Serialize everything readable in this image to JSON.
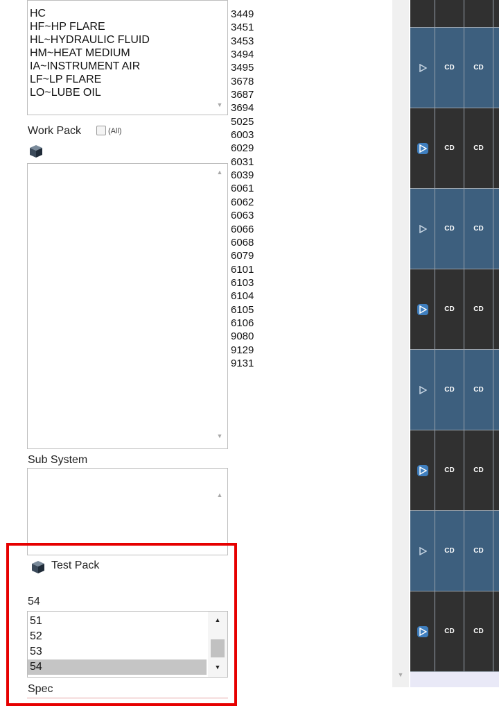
{
  "fluid_list": {
    "items": [
      "HC",
      "HF~HP FLARE",
      "HL~HYDRAULIC FLUID",
      "HM~HEAT MEDIUM",
      "IA~INSTRUMENT AIR",
      "LF~LP FLARE",
      "LO~LUBE OIL"
    ]
  },
  "work_pack": {
    "label": "Work Pack",
    "all_label": "(All)"
  },
  "sub_system": {
    "label": "Sub System"
  },
  "test_pack": {
    "label": "Test Pack",
    "selected_value": "54",
    "items": [
      "51",
      "52",
      "53",
      "54"
    ],
    "selected_index": 3
  },
  "spec": {
    "label": "Spec"
  },
  "numbers": [
    "3449",
    "3451",
    "3453",
    "3494",
    "3495",
    "3678",
    "3687",
    "3694",
    "5025",
    "6003",
    "6029",
    "6031",
    "6039",
    "6061",
    "6062",
    "6063",
    "6066",
    "6068",
    "6079",
    "6101",
    "6103",
    "6104",
    "6105",
    "6106",
    "9080",
    "9129",
    "9131"
  ],
  "grid": {
    "cell_label": "CD",
    "rows": [
      {
        "style": "dark",
        "btn": "none"
      },
      {
        "style": "blue",
        "btn": "outline"
      },
      {
        "style": "dark",
        "btn": "filled"
      },
      {
        "style": "blue",
        "btn": "outline"
      },
      {
        "style": "dark",
        "btn": "filled"
      },
      {
        "style": "blue",
        "btn": "outline"
      },
      {
        "style": "dark",
        "btn": "filled"
      },
      {
        "style": "blue",
        "btn": "outline"
      },
      {
        "style": "dark",
        "btn": "filled"
      }
    ],
    "colors": {
      "dark": "#303030",
      "blue": "#3d5f7e"
    }
  }
}
